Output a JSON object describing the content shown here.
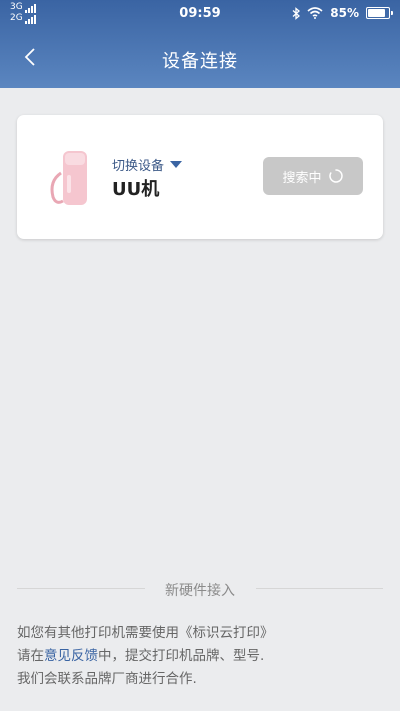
{
  "status_bar": {
    "network_1": "3G",
    "network_2": "2G",
    "time": "09:59",
    "battery_percent": "85%",
    "battery_level": 0.85,
    "icons": [
      "bluetooth-icon",
      "wifi-icon",
      "battery-icon"
    ]
  },
  "nav": {
    "title": "设备连接",
    "back_icon": "chevron-left-icon"
  },
  "device_card": {
    "switch_label": "切换设备",
    "device_name": "UU机",
    "search_button_label": "搜索中"
  },
  "footer": {
    "divider_label": "新硬件接入",
    "line1": "如您有其他打印机需要使用《标识云打印》",
    "line2_prefix": "请在",
    "line2_link": "意见反馈",
    "line2_suffix": "中，提交打印机品牌、型号.",
    "line3": "我们会联系品牌厂商进行合作."
  },
  "colors": {
    "header_top": "#3a64a3",
    "header_bottom": "#5b86c0",
    "link": "#3a64a3",
    "background": "#ebecee",
    "disabled_button": "#c8c8c8"
  }
}
